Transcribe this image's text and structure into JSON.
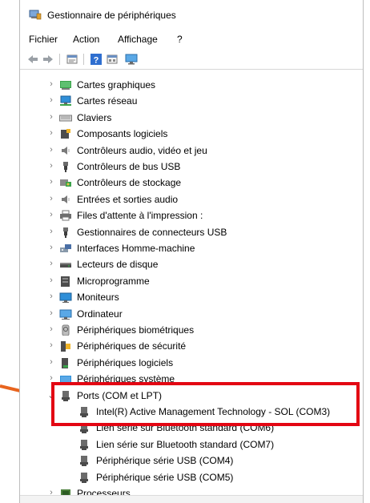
{
  "window": {
    "title": "Gestionnaire de périphériques"
  },
  "menu": [
    "Fichier",
    "Action",
    "Affichage",
    "?"
  ],
  "toolbar": {
    "buttons": [
      {
        "name": "back-arrow-icon"
      },
      {
        "name": "forward-arrow-icon"
      },
      {
        "name": "properties-icon"
      },
      {
        "name": "help-icon"
      },
      {
        "name": "view-icon"
      },
      {
        "name": "monitor-scan-icon"
      }
    ]
  },
  "tree": {
    "categories": [
      {
        "label": "Cartes graphiques",
        "icon": "display-adapter-icon"
      },
      {
        "label": "Cartes réseau",
        "icon": "network-adapter-icon"
      },
      {
        "label": "Claviers",
        "icon": "keyboard-icon"
      },
      {
        "label": "Composants logiciels",
        "icon": "software-component-icon"
      },
      {
        "label": "Contrôleurs audio, vidéo et jeu",
        "icon": "speaker-icon"
      },
      {
        "label": "Contrôleurs de bus USB",
        "icon": "usb-icon"
      },
      {
        "label": "Contrôleurs de stockage",
        "icon": "storage-controller-icon"
      },
      {
        "label": "Entrées et sorties audio",
        "icon": "speaker-icon"
      },
      {
        "label": "Files d'attente à l'impression :",
        "icon": "printer-icon"
      },
      {
        "label": "Gestionnaires de connecteurs USB",
        "icon": "usb-icon"
      },
      {
        "label": "Interfaces Homme-machine",
        "icon": "hid-icon"
      },
      {
        "label": "Lecteurs de disque",
        "icon": "disk-drive-icon"
      },
      {
        "label": "Microprogramme",
        "icon": "firmware-icon"
      },
      {
        "label": "Moniteurs",
        "icon": "monitor-icon"
      },
      {
        "label": "Ordinateur",
        "icon": "computer-icon"
      },
      {
        "label": "Périphériques biométriques",
        "icon": "fingerprint-icon"
      },
      {
        "label": "Périphériques de sécurité",
        "icon": "security-device-icon"
      },
      {
        "label": "Périphériques logiciels",
        "icon": "software-device-icon"
      },
      {
        "label": "Périphériques système",
        "icon": "system-device-icon"
      }
    ],
    "ports": {
      "label": "Ports (COM et LPT)",
      "children": [
        "Intel(R) Active Management Technology - SOL (COM3)",
        "Lien série sur Bluetooth standard (COM6)",
        "Lien série sur Bluetooth standard (COM7)",
        "Périphérique série USB (COM4)",
        "Périphérique série USB (COM5)"
      ]
    },
    "after": [
      {
        "label": "Processeurs",
        "icon": "processor-icon"
      }
    ]
  },
  "colors": {
    "highlight": "#e30613",
    "arrow": "#e8641e",
    "monitor_blue": "#2f8fd8"
  }
}
